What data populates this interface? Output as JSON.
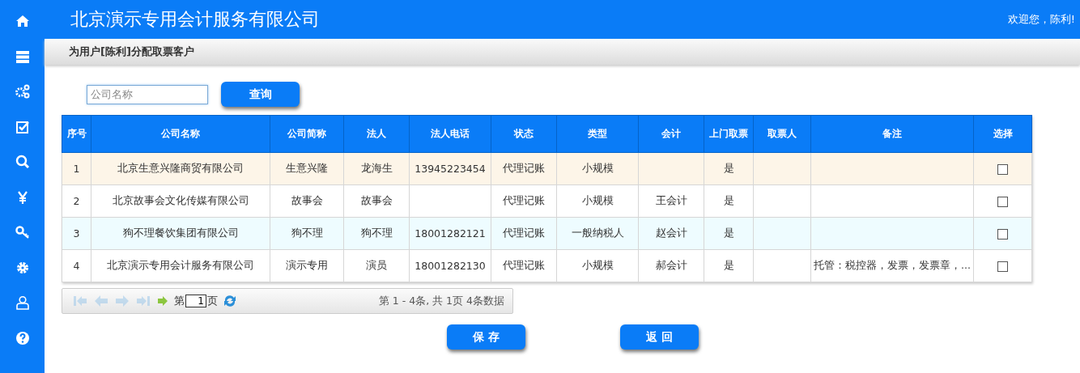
{
  "header": {
    "title": "北京演示专用会计服务有限公司",
    "greeting": "欢迎您，陈利!"
  },
  "sidebar": {
    "items": [
      {
        "kind": "home"
      },
      {
        "kind": "stack"
      },
      {
        "kind": "gears"
      },
      {
        "kind": "check"
      },
      {
        "kind": "search"
      },
      {
        "kind": "yen"
      },
      {
        "kind": "key"
      },
      {
        "kind": "gear"
      },
      {
        "kind": "user"
      },
      {
        "kind": "help"
      }
    ]
  },
  "page_title": "为用户[陈利]分配取票客户",
  "search": {
    "placeholder": "公司名称",
    "button": "查询"
  },
  "table": {
    "columns": [
      "序号",
      "公司名称",
      "公司简称",
      "法人",
      "法人电话",
      "状态",
      "类型",
      "会计",
      "上门取票",
      "取票人",
      "备注",
      "选择"
    ],
    "rows": [
      {
        "highlighted": true,
        "cells": [
          "1",
          "北京生意兴隆商贸有限公司",
          "生意兴隆",
          "龙海生",
          "13945223454",
          "代理记账",
          "小规模",
          "",
          "是",
          "",
          ""
        ],
        "checked": false
      },
      {
        "highlighted": false,
        "cells": [
          "2",
          "北京故事会文化传媒有限公司",
          "故事会",
          "故事会",
          "",
          "代理记账",
          "小规模",
          "王会计",
          "是",
          "",
          ""
        ],
        "checked": false
      },
      {
        "highlighted": false,
        "cells": [
          "3",
          "狗不理餐饮集团有限公司",
          "狗不理",
          "狗不理",
          "18001282121",
          "代理记账",
          "一般纳税人",
          "赵会计",
          "是",
          "",
          ""
        ],
        "checked": false
      },
      {
        "highlighted": false,
        "cells": [
          "4",
          "北京演示专用会计服务有限公司",
          "演示专用",
          "演员",
          "18001282130",
          "代理记账",
          "小规模",
          "郝会计",
          "是",
          "",
          "托管：税控器，发票，发票章，..."
        ],
        "checked": false
      }
    ]
  },
  "pager": {
    "page_prefix": "第",
    "page": "1",
    "page_suffix": "页",
    "summary": "第 1 - 4条, 共 1页 4条数据",
    "nav_disabled": true
  },
  "buttons": [
    "保 存",
    "返 回"
  ]
}
